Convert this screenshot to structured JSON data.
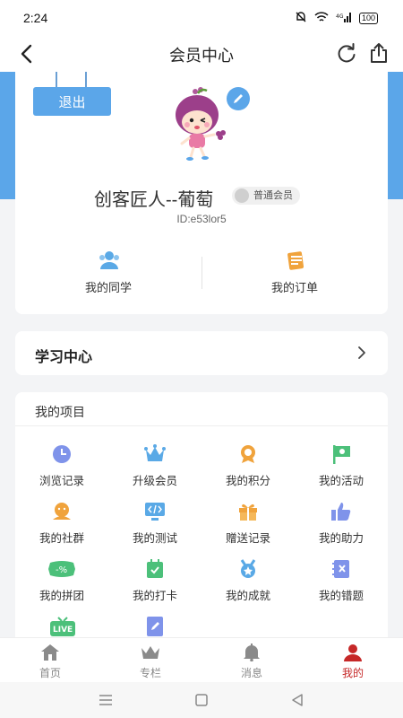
{
  "status_bar": {
    "time": "2:24",
    "signal": "4G",
    "battery": "100"
  },
  "nav": {
    "title": "会员中心"
  },
  "profile": {
    "logout_label": "退出",
    "name": "创客匠人--葡萄",
    "member_level": "普通会员",
    "user_id": "ID:e53lor5",
    "stats": [
      {
        "label": "我的同学",
        "icon": "classmates-icon"
      },
      {
        "label": "我的订单",
        "icon": "orders-icon"
      }
    ]
  },
  "learning_center": {
    "title": "学习中心"
  },
  "projects": {
    "header": "我的项目",
    "items": [
      {
        "label": "浏览记录",
        "icon": "clock-icon",
        "color": "#7f93ea"
      },
      {
        "label": "升级会员",
        "icon": "crown-icon",
        "color": "#5aa9e6"
      },
      {
        "label": "我的积分",
        "icon": "medal-icon",
        "color": "#f0a33c"
      },
      {
        "label": "我的活动",
        "icon": "flag-icon",
        "color": "#4cc07a"
      },
      {
        "label": "我的社群",
        "icon": "community-icon",
        "color": "#f0a33c"
      },
      {
        "label": "我的测试",
        "icon": "code-icon",
        "color": "#5aa9e6"
      },
      {
        "label": "赠送记录",
        "icon": "gift-icon",
        "color": "#f0a33c"
      },
      {
        "label": "我的助力",
        "icon": "thumbs-up-icon",
        "color": "#7f93ea"
      },
      {
        "label": "我的拼团",
        "icon": "discount-icon",
        "color": "#4cc07a"
      },
      {
        "label": "我的打卡",
        "icon": "calendar-check-icon",
        "color": "#4cc07a"
      },
      {
        "label": "我的成就",
        "icon": "achievement-icon",
        "color": "#5aa9e6"
      },
      {
        "label": "我的错题",
        "icon": "wrong-book-icon",
        "color": "#7f93ea"
      },
      {
        "label": "LIVE",
        "icon": "live-icon",
        "color": "#4cc07a"
      },
      {
        "label": "",
        "icon": "notes-icon",
        "color": "#7f93ea"
      }
    ]
  },
  "tabs": [
    {
      "label": "首页",
      "icon": "home-icon",
      "active": false
    },
    {
      "label": "专栏",
      "icon": "crown-icon",
      "active": false
    },
    {
      "label": "消息",
      "icon": "bell-icon",
      "active": false
    },
    {
      "label": "我的",
      "icon": "person-icon",
      "active": true
    }
  ],
  "colors": {
    "accent": "#5ba6e9",
    "active_tab": "#c62828"
  }
}
